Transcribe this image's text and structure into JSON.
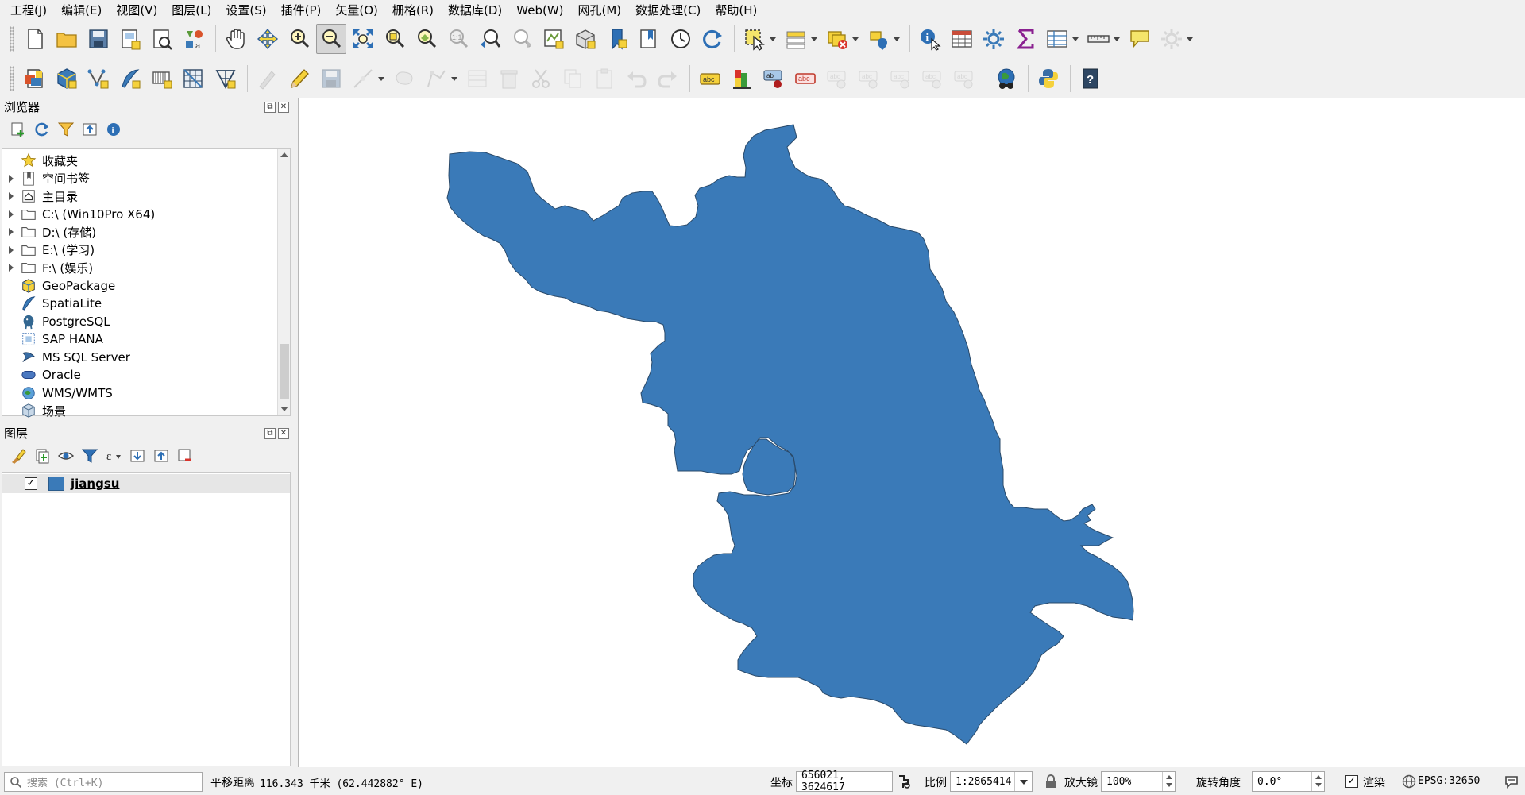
{
  "menu": [
    "工程(J)",
    "编辑(E)",
    "视图(V)",
    "图层(L)",
    "设置(S)",
    "插件(P)",
    "矢量(O)",
    "栅格(R)",
    "数据库(D)",
    "Web(W)",
    "网孔(M)",
    "数据处理(C)",
    "帮助(H)"
  ],
  "toolbar1": [
    {
      "name": "new-project-icon",
      "glyph": "doc"
    },
    {
      "name": "open-project-icon",
      "glyph": "folder"
    },
    {
      "name": "save-project-icon",
      "glyph": "save"
    },
    {
      "name": "new-print-layout-icon",
      "glyph": "layout"
    },
    {
      "name": "layout-manager-icon",
      "glyph": "layout2"
    },
    {
      "name": "style-manager-icon",
      "glyph": "style"
    },
    {
      "name": "pan-map-icon",
      "glyph": "hand"
    },
    {
      "name": "pan-to-selection-icon",
      "glyph": "pan-sel"
    },
    {
      "name": "zoom-in-icon",
      "glyph": "zoom-in"
    },
    {
      "name": "zoom-out-icon",
      "glyph": "zoom-out",
      "pressed": true
    },
    {
      "name": "zoom-full-icon",
      "glyph": "zoom-full"
    },
    {
      "name": "zoom-to-selection-icon",
      "glyph": "zoom-sel"
    },
    {
      "name": "zoom-to-layer-icon",
      "glyph": "zoom-layer"
    },
    {
      "name": "zoom-native-icon",
      "glyph": "zoom-11"
    },
    {
      "name": "zoom-last-icon",
      "glyph": "zoom-last"
    },
    {
      "name": "zoom-next-icon",
      "glyph": "zoom-next"
    },
    {
      "name": "new-map-view-icon",
      "glyph": "mapview"
    },
    {
      "name": "new-3d-map-view-icon",
      "glyph": "map3d"
    },
    {
      "name": "new-bookmark-icon",
      "glyph": "bookmark"
    },
    {
      "name": "show-bookmarks-icon",
      "glyph": "bookmarks"
    },
    {
      "name": "temporal-controller-icon",
      "glyph": "clock"
    },
    {
      "name": "refresh-icon",
      "glyph": "refresh"
    },
    {
      "name": "select-features-icon",
      "glyph": "select",
      "drop": true
    },
    {
      "name": "select-by-value-icon",
      "glyph": "select-val",
      "drop": true
    },
    {
      "name": "deselect-all-icon",
      "glyph": "deselect",
      "drop": true
    },
    {
      "name": "select-location-icon",
      "glyph": "select-loc",
      "drop": true
    },
    {
      "name": "identify-features-icon",
      "glyph": "identify"
    },
    {
      "name": "attribute-table-icon",
      "glyph": "table"
    },
    {
      "name": "toolbox-icon",
      "glyph": "gear"
    },
    {
      "name": "statistics-icon",
      "glyph": "sigma"
    },
    {
      "name": "open-field-calculator-icon",
      "glyph": "fieldcalc",
      "drop": true
    },
    {
      "name": "measure-line-icon",
      "glyph": "ruler",
      "drop": true
    },
    {
      "name": "map-tips-icon",
      "glyph": "tips"
    },
    {
      "name": "settings-disabled-icon",
      "glyph": "gear-dis",
      "drop": true,
      "disabled": true
    }
  ],
  "toolbar2": [
    {
      "name": "data-source-manager-icon",
      "glyph": "dsm"
    },
    {
      "name": "new-geopackage-layer-icon",
      "glyph": "gpkg"
    },
    {
      "name": "new-shapefile-layer-icon",
      "glyph": "shp"
    },
    {
      "name": "new-spatialite-layer-icon",
      "glyph": "spatialite"
    },
    {
      "name": "new-temporary-layer-icon",
      "glyph": "temp"
    },
    {
      "name": "new-virtual-layer-icon",
      "glyph": "virtual"
    },
    {
      "name": "new-mesh-layer-icon",
      "glyph": "mesh"
    },
    {
      "name": "current-edits-icon",
      "glyph": "edits",
      "disabled": true
    },
    {
      "name": "toggle-editing-icon",
      "glyph": "pencil"
    },
    {
      "name": "save-edits-icon",
      "glyph": "save",
      "disabled": true
    },
    {
      "name": "digitize-icon",
      "glyph": "digitize",
      "drop": true,
      "disabled": true
    },
    {
      "name": "add-feature-icon",
      "glyph": "addfeat",
      "disabled": true
    },
    {
      "name": "vertex-tool-icon",
      "glyph": "vertex",
      "drop": true,
      "disabled": true
    },
    {
      "name": "modify-attributes-icon",
      "glyph": "modattr",
      "disabled": true
    },
    {
      "name": "delete-selected-icon",
      "glyph": "trash",
      "disabled": true
    },
    {
      "name": "cut-features-icon",
      "glyph": "cut",
      "disabled": true
    },
    {
      "name": "copy-features-icon",
      "glyph": "copy",
      "disabled": true
    },
    {
      "name": "paste-features-icon",
      "glyph": "paste",
      "disabled": true
    },
    {
      "name": "undo-icon",
      "glyph": "undo",
      "disabled": true
    },
    {
      "name": "redo-icon",
      "glyph": "redo",
      "disabled": true
    },
    {
      "name": "label-toolbar-icon",
      "glyph": "abc"
    },
    {
      "name": "layer-diagram-icon",
      "glyph": "diagram"
    },
    {
      "name": "pin-labels-icon",
      "glyph": "abc-pin"
    },
    {
      "name": "highlight-labels-icon",
      "glyph": "abc-red"
    },
    {
      "name": "move-label-icon",
      "glyph": "abc-move",
      "disabled": true
    },
    {
      "name": "show-hide-labels-icon",
      "glyph": "abc-eye",
      "disabled": true
    },
    {
      "name": "rotate-label-icon",
      "glyph": "abc-rot",
      "disabled": true
    },
    {
      "name": "change-label-icon",
      "glyph": "abc-chg",
      "disabled": true
    },
    {
      "name": "label-properties-icon",
      "glyph": "abc-prop",
      "disabled": true
    },
    {
      "name": "georeferencer-icon",
      "glyph": "globe"
    },
    {
      "name": "python-console-icon",
      "glyph": "python"
    },
    {
      "name": "help-icon",
      "glyph": "help"
    }
  ],
  "browser": {
    "title": "浏览器",
    "tools": [
      "add-selected-icon",
      "refresh-icon",
      "filter-icon",
      "collapse-all-icon",
      "properties-icon"
    ],
    "items": [
      {
        "label": "收藏夹",
        "icon": "star-icon",
        "expandable": false
      },
      {
        "label": "空间书签",
        "icon": "bookmark-icon",
        "expandable": true
      },
      {
        "label": "主目录",
        "icon": "home-icon",
        "expandable": true
      },
      {
        "label": "C:\\ (Win10Pro X64)",
        "icon": "drive-icon",
        "expandable": true
      },
      {
        "label": "D:\\ (存储)",
        "icon": "drive-icon",
        "expandable": true
      },
      {
        "label": "E:\\ (学习)",
        "icon": "drive-icon",
        "expandable": true
      },
      {
        "label": "F:\\ (娱乐)",
        "icon": "drive-icon",
        "expandable": true
      },
      {
        "label": "GeoPackage",
        "icon": "geopackage-icon",
        "expandable": false
      },
      {
        "label": "SpatiaLite",
        "icon": "spatialite-icon",
        "expandable": false
      },
      {
        "label": "PostgreSQL",
        "icon": "postgresql-icon",
        "expandable": false
      },
      {
        "label": "SAP HANA",
        "icon": "sap-hana-icon",
        "expandable": false
      },
      {
        "label": "MS SQL Server",
        "icon": "mssql-icon",
        "expandable": false
      },
      {
        "label": "Oracle",
        "icon": "oracle-icon",
        "expandable": false
      },
      {
        "label": "WMS/WMTS",
        "icon": "wms-icon",
        "expandable": false
      },
      {
        "label": "场景",
        "icon": "scene-icon",
        "expandable": false
      }
    ]
  },
  "layers": {
    "title": "图层",
    "tools": [
      "open-styling-icon",
      "add-group-icon",
      "manage-visibility-icon",
      "filter-legend-icon",
      "filter-expression-icon",
      "expand-all-icon",
      "collapse-all-icon",
      "remove-layer-icon"
    ],
    "items": [
      {
        "label": "jiangsu",
        "checked": true,
        "color": "#3a7ab8"
      }
    ]
  },
  "map": {
    "fill_color": "#3a7ab8",
    "stroke_color": "#2a4a6a",
    "background": "#ffffff"
  },
  "status": {
    "search_placeholder": "搜索 (Ctrl+K)",
    "message_label": "平移距离",
    "message_value": "116.343 千米 (62.442882° E)",
    "coord_label": "坐标",
    "coord_value": "656021, 3624617",
    "scale_label": "比例",
    "scale_value": "1:2865414",
    "magnifier_label": "放大镜",
    "magnifier_value": "100%",
    "rotation_label": "旋转角度",
    "rotation_value": "0.0°",
    "render_label": "渲染",
    "render_checked": true,
    "crs_label": "EPSG:32650"
  }
}
